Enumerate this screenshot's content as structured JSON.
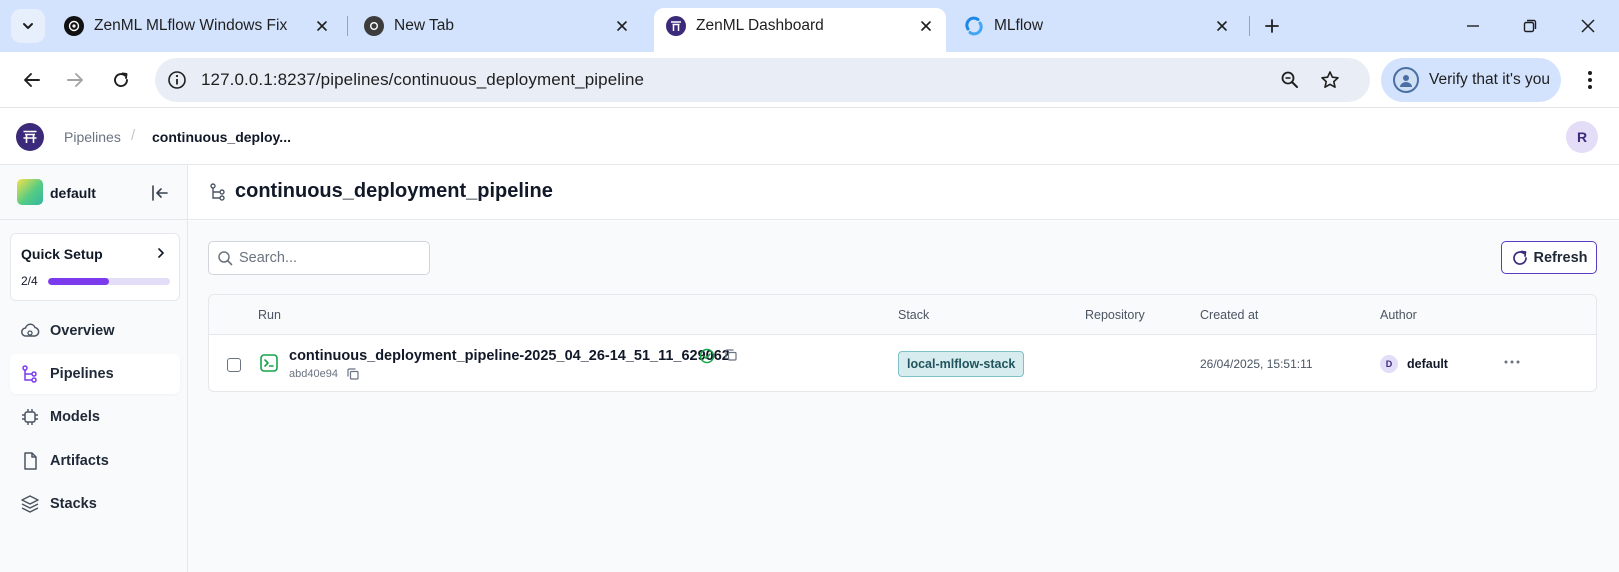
{
  "browser": {
    "tabs": [
      {
        "title": "ZenML MLflow Windows Fix",
        "favicon": "openai-icon",
        "active": false
      },
      {
        "title": "New Tab",
        "favicon": "chrome-icon",
        "active": false
      },
      {
        "title": "ZenML Dashboard",
        "favicon": "zenml-icon",
        "active": true
      },
      {
        "title": "MLflow",
        "favicon": "mlflow-icon",
        "active": false
      }
    ],
    "url": "127.0.0.1:8237/pipelines/continuous_deployment_pipeline",
    "profile_label": "Verify that it's you"
  },
  "app": {
    "breadcrumb": {
      "parent": "Pipelines",
      "separator": "/",
      "current": "continuous_deploy..."
    },
    "user_initial": "R",
    "workspace": "default",
    "quick_setup": {
      "title": "Quick Setup",
      "count": "2/4",
      "progress": 0.5
    },
    "nav": [
      {
        "label": "Overview",
        "icon": "overview-icon"
      },
      {
        "label": "Pipelines",
        "icon": "pipelines-icon",
        "active": true
      },
      {
        "label": "Models",
        "icon": "models-icon"
      },
      {
        "label": "Artifacts",
        "icon": "artifacts-icon"
      },
      {
        "label": "Stacks",
        "icon": "stacks-icon"
      }
    ],
    "page_title": "continuous_deployment_pipeline",
    "search_placeholder": "Search...",
    "refresh_label": "Refresh",
    "table": {
      "columns": [
        "Run",
        "Stack",
        "Repository",
        "Created at",
        "Author"
      ],
      "rows": [
        {
          "run_name": "continuous_deployment_pipeline-2025_04_26-14_51_11_629062",
          "run_id": "abd40e94",
          "status": "completed",
          "stack": "local-mlflow-stack",
          "repository": "",
          "created_at": "26/04/2025, 15:51:11",
          "author_initial": "D",
          "author": "default"
        }
      ]
    }
  },
  "colors": {
    "accent": "#7c3aed",
    "brand": "#3b2a7a",
    "tabstrip": "#d3e3fd",
    "stack_badge_bg": "#d6ecef",
    "success": "#16a34a"
  }
}
